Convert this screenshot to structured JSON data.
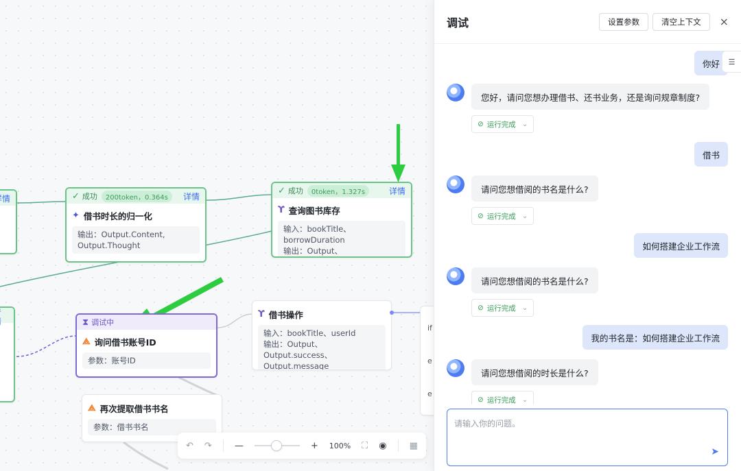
{
  "nodes": {
    "left_top": {
      "detail": "详情"
    },
    "left_bottom": {
      "detail": "详情"
    },
    "normalize": {
      "status": "成功",
      "stats": "200token，0.364s",
      "detail": "详情",
      "title": "借书时长的归一化",
      "body": "输出：Output.Content, Output.Thought"
    },
    "query_stock": {
      "status": "成功",
      "stats": "0token，1.327s",
      "detail": "详情",
      "title": "查询图书库存",
      "input": "输入：bookTitle、borrowDuration",
      "output": "输出：Output、Output.isAvailable"
    },
    "ask_account": {
      "status": "调试中",
      "title": "询问借书账号ID",
      "param": "参数：账号ID"
    },
    "borrow_op": {
      "title": "借书操作",
      "input": "输入：bookTitle、userId",
      "output": "输出：Output、Output.success、Output.message"
    },
    "refetch_title": {
      "title": "再次提取借书书名",
      "param": "参数：借书书名"
    },
    "branch_partial": {
      "line1": "if",
      "line2": "e",
      "line3": "e"
    }
  },
  "toolbar": {
    "zoom": "100%"
  },
  "panel": {
    "title": "调试",
    "set_params": "设置参数",
    "clear_context": "清空上下文",
    "close": "×",
    "input_placeholder": "请输入你的问题。",
    "messages": [
      {
        "role": "user",
        "text": "你好"
      },
      {
        "role": "bot",
        "text": "您好，请问您想办理借书、还书业务，还是询问规章制度?",
        "status": "运行完成"
      },
      {
        "role": "user",
        "text": "借书"
      },
      {
        "role": "bot",
        "text": "请问您想借阅的书名是什么?",
        "status": "运行完成"
      },
      {
        "role": "user",
        "text": "如何搭建企业工作流"
      },
      {
        "role": "bot",
        "text": "请问您想借阅的书名是什么?",
        "status": "运行完成"
      },
      {
        "role": "user",
        "text": "我的书名是：如何搭建企业工作流"
      },
      {
        "role": "bot",
        "text": "请问您想借阅的时长是什么?",
        "status": "运行完成"
      }
    ]
  },
  "colors": {
    "success": "#6cc38a",
    "running": "#7e6ad1",
    "accent": "#4c7cf0",
    "arrow": "#2ecc40",
    "user_bubble": "#dde6fb"
  },
  "icons": {
    "success": "check-circle-icon",
    "running": "hourglass-icon",
    "llm": "sparkle-icon",
    "plugin": "plugin-icon",
    "question": "question-node-icon",
    "send": "send-icon",
    "close": "close-icon"
  }
}
